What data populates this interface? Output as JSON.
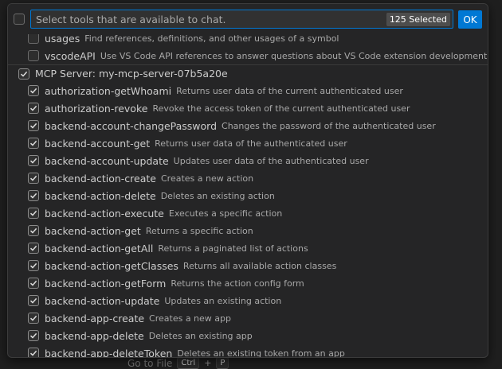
{
  "background": {
    "goto_label": "Go to File",
    "keys": [
      "Ctrl",
      "+",
      "P"
    ]
  },
  "picker": {
    "placeholder": "Select tools that are available to chat.",
    "selected_badge": "125 Selected",
    "ok_label": "OK",
    "accent_color": "#0078d4"
  },
  "prior_tools": [
    {
      "name": "usages",
      "desc": "Find references, definitions, and other usages of a symbol",
      "checked": false
    },
    {
      "name": "vscodeAPI",
      "desc": "Use VS Code API references to answer questions about VS Code extension development.",
      "checked": false
    }
  ],
  "server": {
    "label": "MCP Server: my-mcp-server-07b5a20e",
    "checked": true
  },
  "tools": [
    {
      "name": "authorization-getWhoami",
      "desc": "Returns user data of the current authenticated user"
    },
    {
      "name": "authorization-revoke",
      "desc": "Revoke the access token of the current authenticated user"
    },
    {
      "name": "backend-account-changePassword",
      "desc": "Changes the password of the authenticated user"
    },
    {
      "name": "backend-account-get",
      "desc": "Returns user data of the authenticated user"
    },
    {
      "name": "backend-account-update",
      "desc": "Updates user data of the authenticated user"
    },
    {
      "name": "backend-action-create",
      "desc": "Creates a new action"
    },
    {
      "name": "backend-action-delete",
      "desc": "Deletes an existing action"
    },
    {
      "name": "backend-action-execute",
      "desc": "Executes a specific action"
    },
    {
      "name": "backend-action-get",
      "desc": "Returns a specific action"
    },
    {
      "name": "backend-action-getAll",
      "desc": "Returns a paginated list of actions"
    },
    {
      "name": "backend-action-getClasses",
      "desc": "Returns all available action classes"
    },
    {
      "name": "backend-action-getForm",
      "desc": "Returns the action config form"
    },
    {
      "name": "backend-action-update",
      "desc": "Updates an existing action"
    },
    {
      "name": "backend-app-create",
      "desc": "Creates a new app"
    },
    {
      "name": "backend-app-delete",
      "desc": "Deletes an existing app"
    },
    {
      "name": "backend-app-deleteToken",
      "desc": "Deletes an existing token from an app"
    }
  ]
}
